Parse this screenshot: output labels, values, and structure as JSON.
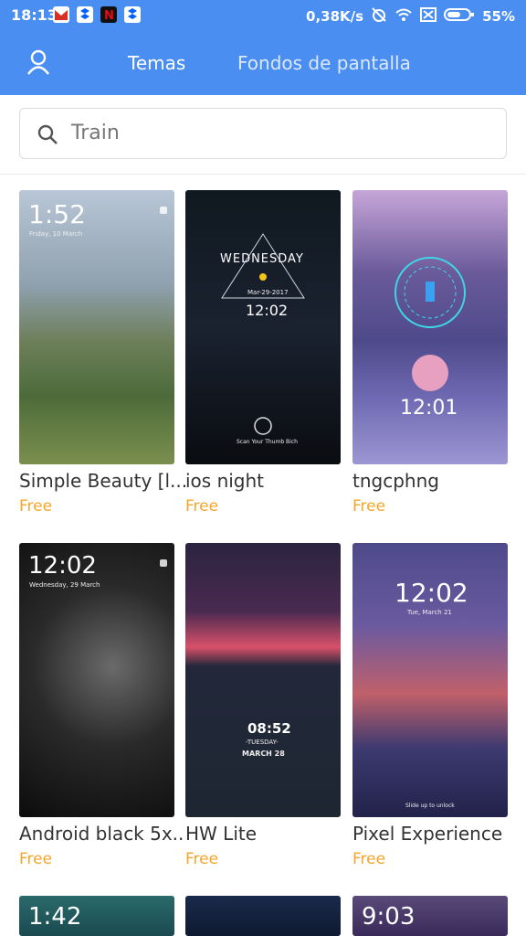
{
  "status_bar": {
    "time": "18:13",
    "speed": "0,38K/s",
    "battery": "55%",
    "icons": [
      "gmail-icon",
      "dropbox-icon",
      "netflix-icon",
      "dropbox-icon",
      "alarm-off-icon",
      "wifi-icon",
      "sim-icon",
      "battery-icon"
    ]
  },
  "tabs": {
    "active": "Temas",
    "other": "Fondos de pantalla"
  },
  "search": {
    "value": "Train"
  },
  "themes": [
    {
      "name": "Simple Beauty [l...",
      "price": "Free",
      "time": "1:52",
      "date": "Friday, 10 March"
    },
    {
      "name": "ios night",
      "price": "Free",
      "time": "12:02",
      "date": "Mar-29-2017",
      "day": "WEDNESDAY",
      "caption": "Scan Your Thumb Bich"
    },
    {
      "name": "tngcphng",
      "price": "Free",
      "time": "12:01"
    },
    {
      "name": "Android black 5x..",
      "price": "Free",
      "time": "12:02",
      "date": "Wednesday, 29 March"
    },
    {
      "name": "HW Lite",
      "price": "Free",
      "time": "08:52",
      "day": "-TUESDAY-",
      "date": "MARCH 28"
    },
    {
      "name": "Pixel Experience",
      "price": "Free",
      "time": "12:02",
      "date": "Tue, March 21",
      "caption": "Slide up to unlock"
    }
  ],
  "partial_row_times": [
    "1:42",
    "",
    "9:03"
  ],
  "colors": {
    "header": "#4a8ef2",
    "price": "#f4a62a"
  }
}
